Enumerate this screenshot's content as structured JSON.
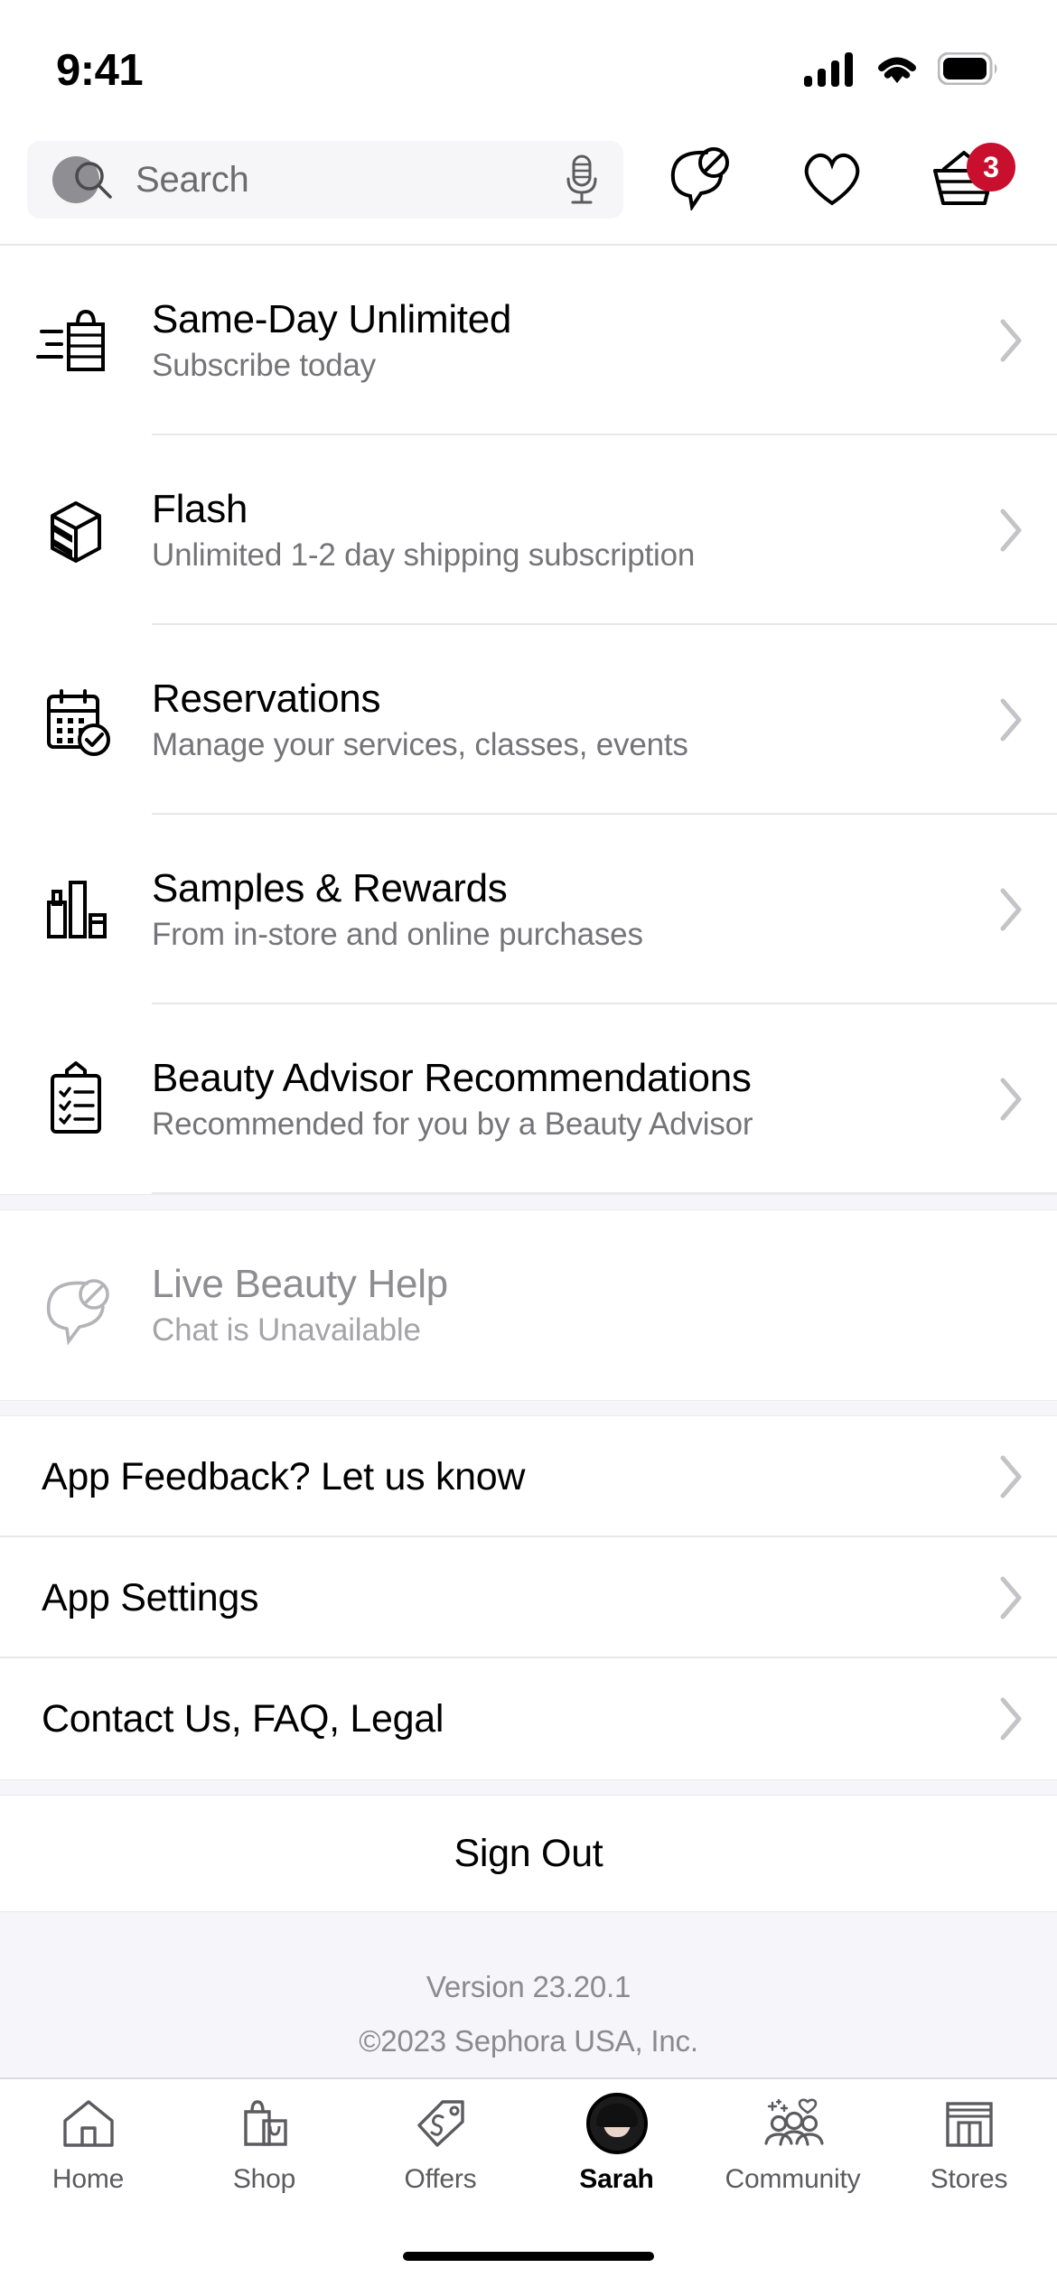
{
  "status_bar": {
    "time": "9:41",
    "signal_icon": "cellular-signal-icon",
    "wifi_icon": "wifi-icon",
    "battery_icon": "battery-full-icon"
  },
  "header": {
    "search": {
      "placeholder": "Search",
      "value": "",
      "search_icon": "search-icon",
      "camera_icon": "camera-scan-icon",
      "mic_icon": "microphone-icon"
    },
    "actions": [
      {
        "name": "live-chat",
        "icon": "chat-unavailable-icon",
        "badge": null
      },
      {
        "name": "loves",
        "icon": "heart-icon",
        "badge": null
      },
      {
        "name": "basket",
        "icon": "basket-icon",
        "badge": "3"
      }
    ],
    "badge_color": "#c8102e"
  },
  "main": {
    "primary_items": [
      {
        "icon": "same-day-delivery-bag-icon",
        "title": "Same-Day Unlimited",
        "subtitle": "Subscribe today",
        "chevron": "chevron-right-icon",
        "enabled": true
      },
      {
        "icon": "flash-package-icon",
        "title": "Flash",
        "subtitle": "Unlimited 1-2 day shipping subscription",
        "chevron": "chevron-right-icon",
        "enabled": true
      },
      {
        "icon": "calendar-check-icon",
        "title": "Reservations",
        "subtitle": "Manage your services, classes, events",
        "chevron": "chevron-right-icon",
        "enabled": true
      },
      {
        "icon": "sample-bottles-icon",
        "title": "Samples & Rewards",
        "subtitle": "From in-store and online purchases",
        "chevron": "chevron-right-icon",
        "enabled": true
      },
      {
        "icon": "clipboard-checklist-icon",
        "title": "Beauty Advisor Recommendations",
        "subtitle": "Recommended for you by a Beauty Advisor",
        "chevron": "chevron-right-icon",
        "enabled": true
      }
    ],
    "chat_item": {
      "icon": "chat-unavailable-icon",
      "title": "Live Beauty Help",
      "subtitle": "Chat is Unavailable",
      "enabled": false
    },
    "link_items": [
      {
        "label": "App Feedback? Let us know",
        "chevron": "chevron-right-icon"
      },
      {
        "label": "App Settings",
        "chevron": "chevron-right-icon"
      },
      {
        "label": "Contact Us, FAQ, Legal",
        "chevron": "chevron-right-icon"
      }
    ],
    "sign_out_label": "Sign Out",
    "footer": {
      "version": "Version 23.20.1",
      "copyright": "©2023 Sephora USA, Inc."
    }
  },
  "tab_bar": {
    "tabs": [
      {
        "label": "Home",
        "icon": "home-icon",
        "active": false
      },
      {
        "label": "Shop",
        "icon": "shopping-bag-icon",
        "active": false
      },
      {
        "label": "Offers",
        "icon": "price-tag-icon",
        "active": false
      },
      {
        "label": "Sarah",
        "icon": "user-avatar",
        "active": true
      },
      {
        "label": "Community",
        "icon": "community-people-icon",
        "active": false
      },
      {
        "label": "Stores",
        "icon": "storefront-icon",
        "active": false
      }
    ],
    "active_color": "#000000",
    "inactive_color": "#5c5c60"
  }
}
